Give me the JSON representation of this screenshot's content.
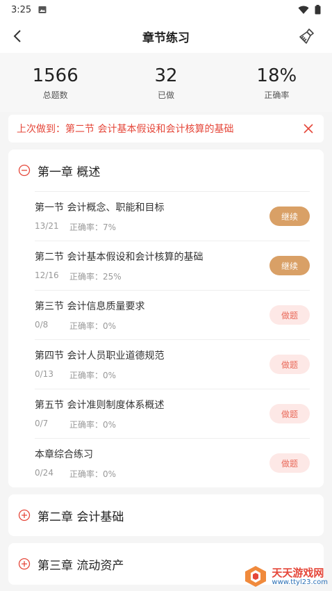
{
  "statusbar": {
    "time": "3:25"
  },
  "header": {
    "title": "章节练习"
  },
  "stats": [
    {
      "value": "1566",
      "label": "总题数"
    },
    {
      "value": "32",
      "label": "已做"
    },
    {
      "value": "18%",
      "label": "正确率"
    }
  ],
  "last": {
    "text": "上次做到：第二节 会计基本假设和会计核算的基础"
  },
  "chapters": [
    {
      "title": "第一章 概述",
      "sections": [
        {
          "name": "第一节 会计概念、职能和目标",
          "count": "13/21",
          "rate": "正确率：7%",
          "button": "继续"
        },
        {
          "name": "第二节 会计基本假设和会计核算的基础",
          "count": "12/16",
          "rate": "正确率：25%",
          "button": "继续"
        },
        {
          "name": "第三节 会计信息质量要求",
          "count": "0/8",
          "rate": "正确率：0%",
          "button": "做题"
        },
        {
          "name": "第四节 会计人员职业道德规范",
          "count": "0/13",
          "rate": "正确率：0%",
          "button": "做题"
        },
        {
          "name": "第五节 会计准则制度体系概述",
          "count": "0/7",
          "rate": "正确率：0%",
          "button": "做题"
        },
        {
          "name": "本章综合练习",
          "count": "0/24",
          "rate": "正确率：0%",
          "button": "做题"
        }
      ]
    },
    {
      "title": "第二章 会计基础"
    },
    {
      "title": "第三章 流动资产"
    }
  ],
  "watermark": {
    "title": "天天游戏网",
    "url": "www.ttyl23.com"
  },
  "colors": {
    "accent": "#e5473a",
    "continue": "#d9a066",
    "do_bg": "#fde8e6",
    "do_text": "#e96a5a"
  }
}
